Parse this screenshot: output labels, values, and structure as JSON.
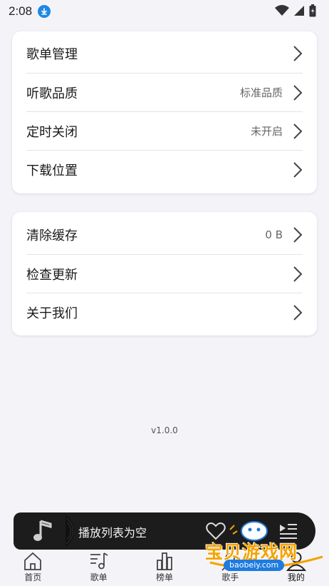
{
  "status_bar": {
    "time": "2:08",
    "icons": [
      "download-icon",
      "wifi-icon",
      "signal-icon",
      "battery-icon"
    ]
  },
  "settings_group_1": [
    {
      "label": "歌单管理",
      "value": ""
    },
    {
      "label": "听歌品质",
      "value": "标准品质"
    },
    {
      "label": "定时关闭",
      "value": "未开启"
    },
    {
      "label": "下载位置",
      "value": ""
    }
  ],
  "settings_group_2": [
    {
      "label": "清除缓存",
      "value": "0 B"
    },
    {
      "label": "检查更新",
      "value": ""
    },
    {
      "label": "关于我们",
      "value": ""
    }
  ],
  "version": "v1.0.0",
  "player": {
    "text": "播放列表为空"
  },
  "nav": [
    {
      "label": "首页",
      "icon": "home-icon"
    },
    {
      "label": "歌单",
      "icon": "playlist-icon"
    },
    {
      "label": "榜单",
      "icon": "chart-icon"
    },
    {
      "label": "歌手",
      "icon": "singer-icon"
    },
    {
      "label": "我的",
      "icon": "user-icon"
    }
  ],
  "watermark": {
    "text": "宝贝游戏网",
    "url": "baobeiy.com"
  },
  "colors": {
    "background": "#f4f4f8",
    "card": "#ffffff",
    "player_bg": "#1c1c1c",
    "download_badge": "#1e88e5",
    "watermark_orange": "#f5a300"
  }
}
